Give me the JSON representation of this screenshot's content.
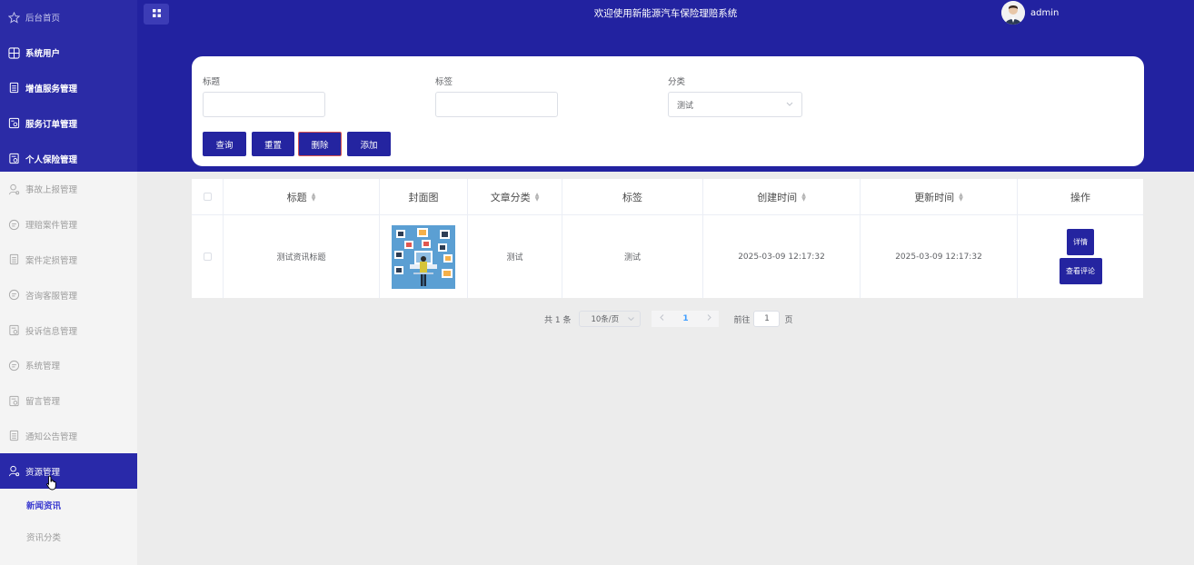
{
  "sidebar": {
    "top_items": [
      {
        "label": "后台首页",
        "icon": "star-icon"
      },
      {
        "label": "系统用户",
        "icon": "grid-icon"
      },
      {
        "label": "增值服务管理",
        "icon": "document-icon"
      },
      {
        "label": "服务订单管理",
        "icon": "search-document-icon"
      },
      {
        "label": "个人保险管理",
        "icon": "search-document-icon"
      }
    ],
    "lower_items": [
      {
        "label": "事故上报管理",
        "icon": "user-icon"
      },
      {
        "label": "理赔案件管理",
        "icon": "chat-icon"
      },
      {
        "label": "案件定损管理",
        "icon": "document-icon"
      },
      {
        "label": "咨询客服管理",
        "icon": "chat-icon"
      },
      {
        "label": "投诉信息管理",
        "icon": "search-document-icon"
      },
      {
        "label": "系统管理",
        "icon": "chat-icon"
      },
      {
        "label": "留言管理",
        "icon": "search-document-icon"
      },
      {
        "label": "通知公告管理",
        "icon": "document-icon"
      },
      {
        "label": "资源管理",
        "icon": "user-icon"
      }
    ],
    "sub_items": [
      {
        "label": "新闻资讯"
      },
      {
        "label": "资讯分类"
      }
    ]
  },
  "header": {
    "title": "欢迎使用新能源汽车保险理赔系统",
    "username": "admin"
  },
  "search": {
    "title_label": "标题",
    "tag_label": "标签",
    "category_label": "分类",
    "title_value": "",
    "tag_value": "",
    "category_value": "测试",
    "buttons": {
      "query": "查询",
      "reset": "重置",
      "delete": "删除",
      "add": "添加"
    }
  },
  "table": {
    "headers": {
      "title": "标题",
      "cover": "封面图",
      "category": "文章分类",
      "tag": "标签",
      "created": "创建时间",
      "updated": "更新时间",
      "actions": "操作"
    },
    "rows": [
      {
        "title": "测试资讯标题",
        "category": "测试",
        "tag": "测试",
        "created": "2025-03-09 12:17:32",
        "updated": "2025-03-09 12:17:32",
        "detail_label": "详情",
        "comments_label": "查看评论"
      }
    ]
  },
  "pagination": {
    "total_text": "共 1 条",
    "page_size": "10条/页",
    "current_page": "1",
    "goto_label": "前往",
    "goto_value": "1",
    "page_unit": "页"
  },
  "colors": {
    "primary": "#2424a0",
    "header_bg": "#2222a0",
    "active_menu": "#2929a9"
  }
}
